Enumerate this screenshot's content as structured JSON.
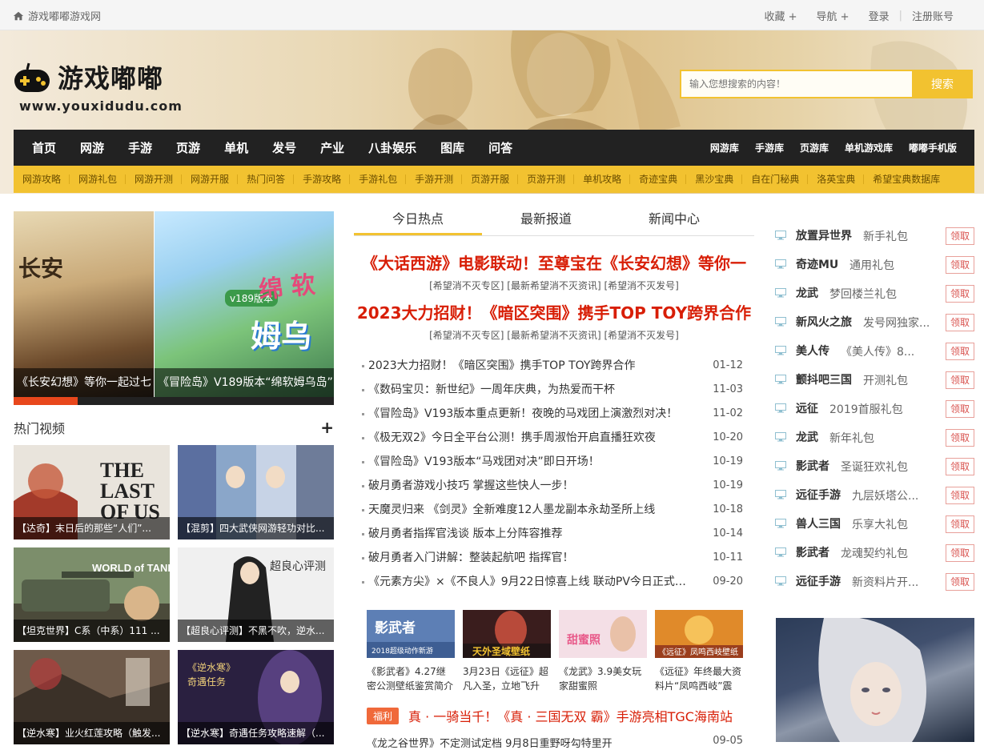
{
  "topbar": {
    "home_label": "游戏嘟嘟游戏网",
    "links": [
      "收藏 +",
      "导航 +",
      "登录",
      "注册账号"
    ]
  },
  "logo": {
    "name": "游戏嘟嘟",
    "url": "www.youxidudu.com"
  },
  "search": {
    "placeholder": "输入您想搜索的内容！",
    "button": "搜索"
  },
  "main_nav": {
    "left": [
      "首页",
      "网游",
      "手游",
      "页游",
      "单机",
      "发号",
      "产业",
      "八卦娱乐",
      "图库",
      "问答"
    ],
    "right": [
      "网游库",
      "手游库",
      "页游库",
      "单机游戏库",
      "嘟嘟手机版"
    ]
  },
  "sub_nav": [
    "网游攻略",
    "网游礼包",
    "网游开测",
    "网游开服",
    "热门问答",
    "手游攻略",
    "手游礼包",
    "手游开测",
    "页游开服",
    "页游开测",
    "单机攻略",
    "奇迹宝典",
    "黑沙宝典",
    "自在门秘典",
    "洛英宝典",
    "希望宝典数据库"
  ],
  "slider": {
    "captions": [
      "《长安幻想》等你一起过七",
      "《冒险岛》V189版本“绵软姆乌岛”"
    ],
    "art_text": {
      "s1": "长安",
      "s2_a": "绵 软",
      "s2_b": "姆乌",
      "s2_tag": "v189版本"
    },
    "progress": 0.2
  },
  "videos": {
    "title": "热门视频",
    "items": [
      "【达奇】末日后的那些“人们”...",
      "【混剪】四大武侠网游轻功对比...",
      "【坦克世界】C系（中系）111 ...",
      "【超良心评测】不黑不吹，逆水...",
      "【逆水寒】业火红莲攻略（触发...",
      "【逆水寒】奇遇任务攻略速解（..."
    ],
    "art_text": {
      "v1": "THE LAST OF US",
      "v3": "WORLD of TANKS",
      "v4": "超良心评测",
      "v6": "《逆水寒》 奇遇任务"
    }
  },
  "tabs": [
    "今日热点",
    "最新报道",
    "新闻中心"
  ],
  "headlines": [
    {
      "title": "《大话西游》电影联动！至尊宝在《长安幻想》等你一",
      "sub": "[希望消不灭专区] [最新希望消不灭资讯] [希望消不灭发号]"
    },
    {
      "title": "2023大力招财！《暗区突围》携手TOP TOY跨界合作",
      "sub": "[希望消不灭专区] [最新希望消不灭资讯] [希望消不灭发号]"
    }
  ],
  "news": [
    {
      "t": "2023大力招财！《暗区突围》携手TOP TOY跨界合作",
      "d": "01-12"
    },
    {
      "t": "《数码宝贝：新世纪》一周年庆典，为热爱而干杯",
      "d": "11-03"
    },
    {
      "t": "《冒险岛》V193版本重点更新！夜晚的马戏团上演激烈对决！",
      "d": "11-02"
    },
    {
      "t": "《极无双2》今日全平台公测！携手周淑怡开启直播狂欢夜",
      "d": "10-20"
    },
    {
      "t": "《冒险岛》V193版本“马戏团对决”即日开场！",
      "d": "10-19"
    },
    {
      "t": "破月勇者游戏小技巧 掌握这些快人一步！",
      "d": "10-19"
    },
    {
      "t": "天魔灵归来 《剑灵》全新难度12人墨龙副本永劫圣所上线",
      "d": "10-18"
    },
    {
      "t": "破月勇者指挥官浅谈 版本上分阵容推荐",
      "d": "10-14"
    },
    {
      "t": "破月勇者入门讲解：整装起航吧 指挥官！",
      "d": "10-11"
    },
    {
      "t": "《元素方尖》×《不良人》9月22日惊喜上线 联动PV今日正式公...",
      "d": "09-20"
    }
  ],
  "thumbs": [
    {
      "c": "《影武者》4.27继密公测壁纸鉴赏简介",
      "art": "影武者 2018超级动作新游"
    },
    {
      "c": "3月23日《远征》超凡入圣，立地飞升",
      "art": "天外圣域壁纸"
    },
    {
      "c": "《龙武》3.9美女玩家甜蜜照",
      "art": "甜蜜照"
    },
    {
      "c": "《远征》年终最大资料片“凤鸣西岐”震",
      "art": "《远征》凤鸣西岐壁纸"
    }
  ],
  "welfare": {
    "tag": "福利",
    "title": "真 · 一骑当千！《真 · 三国无双 霸》手游亮相TGC海南站"
  },
  "cut_row": {
    "t": "《龙之谷世界》不定测试定档 9月8日重野呀勾特里开",
    "d": "09-05"
  },
  "gifts": [
    {
      "game": "放置异世界",
      "name": "新手礼包"
    },
    {
      "game": "奇迹MU",
      "name": "通用礼包"
    },
    {
      "game": "龙武",
      "name": "梦回楼兰礼包"
    },
    {
      "game": "新风火之旅",
      "name": "发号网独家..."
    },
    {
      "game": "美人传",
      "name": "《美人传》8..."
    },
    {
      "game": "颤抖吧三国",
      "name": "开测礼包"
    },
    {
      "game": "远征",
      "name": "2019首服礼包"
    },
    {
      "game": "龙武",
      "name": "新年礼包"
    },
    {
      "game": "影武者",
      "name": "圣诞狂欢礼包"
    },
    {
      "game": "远征手游",
      "name": "九层妖塔公..."
    },
    {
      "game": "兽人三国",
      "name": "乐享大礼包"
    },
    {
      "game": "影武者",
      "name": "龙魂契约礼包"
    },
    {
      "game": "远征手游",
      "name": "新资料片开..."
    }
  ],
  "gift_button": "领取",
  "colors": {
    "accent": "#f2c230",
    "headline_red": "#d81e06",
    "nav_dark": "#222222"
  }
}
